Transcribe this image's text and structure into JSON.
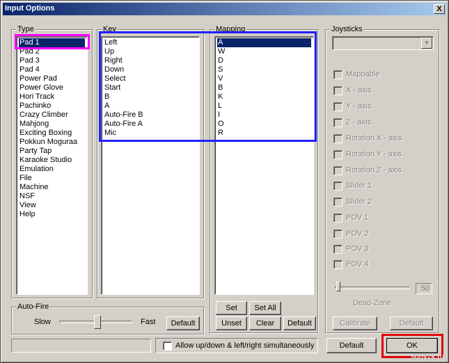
{
  "window": {
    "title": "Input Options",
    "close_label": "X"
  },
  "type_group": {
    "label": "Type",
    "items": [
      "Pad 1",
      "Pad 2",
      "Pad 3",
      "Pad 4",
      "Power Pad",
      "Power Glove",
      "Hori Track",
      "Pachinko",
      "Crazy Climber",
      "Mahjong",
      "Exciting Boxing",
      "Pokkun Moguraa",
      "Party Tap",
      "Karaoke Studio",
      "Emulation",
      "File",
      "Machine",
      "NSF",
      "View",
      "Help"
    ],
    "selected": "Pad 1"
  },
  "key_group": {
    "label": "Key",
    "items": [
      "Left",
      "Up",
      "Right",
      "Down",
      "Select",
      "Start",
      "B",
      "A",
      "Auto-Fire B",
      "Auto-Fire A",
      "Mic"
    ]
  },
  "mapping_group": {
    "label": "Mapping",
    "items": [
      "A",
      "W",
      "D",
      "S",
      "V",
      "B",
      "K",
      "L",
      "I",
      "O",
      "R"
    ],
    "selected": "A",
    "set_label": "Set",
    "set_all_label": "Set All",
    "unset_label": "Unset",
    "clear_label": "Clear",
    "default_label": "Default"
  },
  "autofire_group": {
    "label": "Auto-Fire",
    "slow_label": "Slow",
    "fast_label": "Fast",
    "default_label": "Default",
    "speed_fraction": 0.5
  },
  "joysticks_group": {
    "label": "Joysticks",
    "checkboxes": [
      "Mappable",
      "X - axis",
      "Y - axis",
      "Z - axis",
      "Rotation X - axis",
      "Rotation Y - axis",
      "Rotation Z - axis",
      "Slider 1",
      "Slider 2",
      "POV 1",
      "POV 2",
      "POV 3",
      "POV 4"
    ],
    "deadzone_value": "50",
    "deadzone_label": "Dead-Zone",
    "calibrate_label": "Calibrate",
    "default_label": "Default"
  },
  "footer": {
    "allow_label": "Allow up/down & left/right simultaneously",
    "default_label": "Default",
    "ok_label": "OK"
  },
  "watermark": "sony2k.ru",
  "colors": {
    "highlight_magenta": "#ff00ff",
    "highlight_blue": "#2020ff",
    "highlight_red": "#e00000",
    "selection": "#0a246a"
  }
}
